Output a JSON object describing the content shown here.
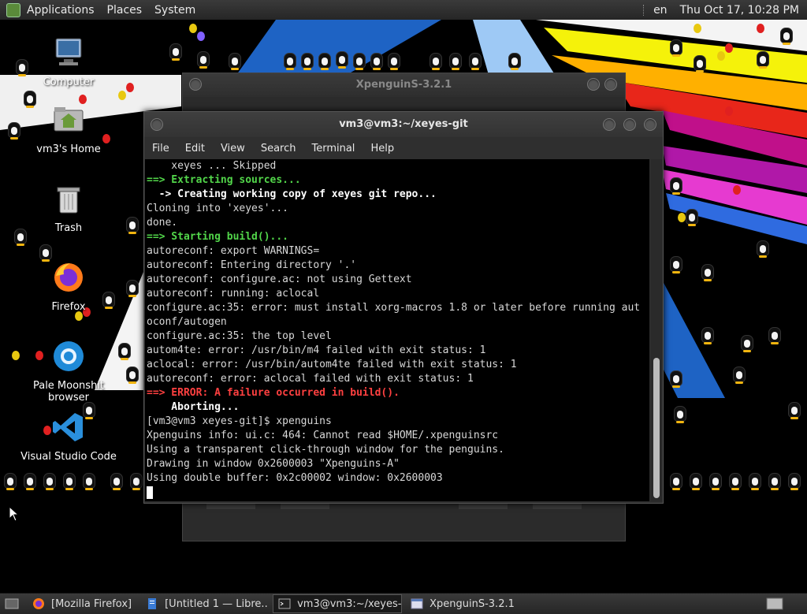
{
  "top_panel": {
    "menus": [
      "Applications",
      "Places",
      "System"
    ],
    "keyboard_layout": "en",
    "datetime": "Thu Oct 17, 10:28 PM"
  },
  "desktop_icons": [
    {
      "label": "Computer",
      "icon": "computer-icon"
    },
    {
      "label": "vm3's Home",
      "icon": "home-folder-icon"
    },
    {
      "label": "Trash",
      "icon": "trash-icon"
    },
    {
      "label": "Firefox",
      "icon": "firefox-icon"
    },
    {
      "label": "Pale Moonshit browser",
      "icon": "browser-icon"
    },
    {
      "label": "Visual Studio Code",
      "icon": "vscode-icon"
    }
  ],
  "xpenguins_window": {
    "title": "XpenguinS-3.2.1"
  },
  "terminal": {
    "title": "vm3@vm3:~/xeyes-git",
    "menu": [
      "File",
      "Edit",
      "View",
      "Search",
      "Terminal",
      "Help"
    ],
    "lines": [
      "    xeyes ... Skipped",
      "==> Extracting sources...",
      "  -> Creating working copy of xeyes git repo...",
      "Cloning into 'xeyes'...",
      "done.",
      "==> Starting build()...",
      "autoreconf: export WARNINGS=",
      "autoreconf: Entering directory '.'",
      "autoreconf: configure.ac: not using Gettext",
      "autoreconf: running: aclocal",
      "configure.ac:35: error: must install xorg-macros 1.8 or later before running aut",
      "oconf/autogen",
      "configure.ac:35: the top level",
      "autom4te: error: /usr/bin/m4 failed with exit status: 1",
      "aclocal: error: /usr/bin/autom4te failed with exit status: 1",
      "autoreconf: error: aclocal failed with exit status: 1",
      "==> ERROR: A failure occurred in build().",
      "    Aborting...",
      "[vm3@vm3 xeyes-git]$ xpenguins",
      "Xpenguins info: ui.c: 464: Cannot read $HOME/.xpenguinsrc",
      "Using a transparent click-through window for the penguins.",
      "Drawing in window 0x2600003 \"Xpenguins-A\"",
      "Using double buffer: 0x2c00002 window: 0x2600003"
    ]
  },
  "taskbar": {
    "tasks": [
      {
        "label": "[Mozilla Firefox]",
        "icon": "firefox-icon",
        "active": false
      },
      {
        "label": "[Untitled 1 — Libre...",
        "icon": "document-icon",
        "active": false
      },
      {
        "label": "vm3@vm3:~/xeyes-...",
        "icon": "terminal-icon",
        "active": true
      },
      {
        "label": "XpenguinS-3.2.1",
        "icon": "window-icon",
        "active": false
      }
    ]
  },
  "colors": {
    "terminal_green": "#52d64a",
    "terminal_red": "#ff4040",
    "panel": "#2e2e2e"
  }
}
